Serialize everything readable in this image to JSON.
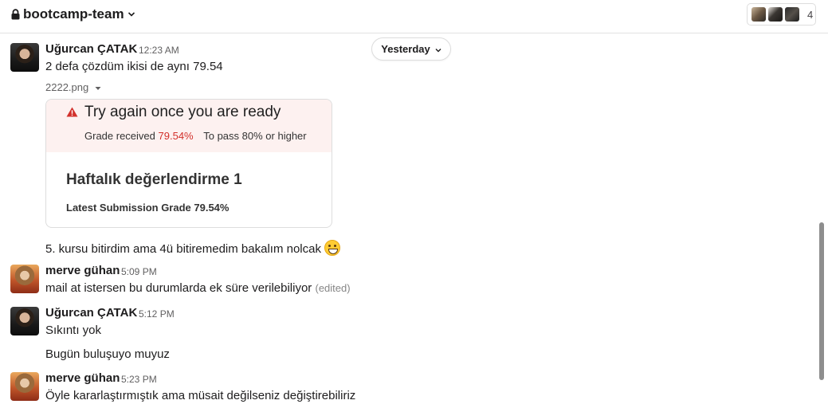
{
  "header": {
    "channel_name": "bootcamp-team",
    "member_count": "4"
  },
  "day_divider": {
    "label": "Yesterday"
  },
  "messages": [
    {
      "author": "Uğurcan ÇATAK",
      "time": "12:23 AM",
      "text": "2 defa çözdüm ikisi de aynı 79.54",
      "file": {
        "name": "2222.png",
        "banner_title": "Try again once you are ready",
        "grade_received_label": "Grade received",
        "grade_received_value": "79.54%",
        "to_pass_label": "To pass",
        "to_pass_value": "80% or higher",
        "assignment_title": "Haftalık değerlendirme 1",
        "latest_submission": "Latest Submission Grade 79.54%"
      },
      "followup": "5. kursu bitirdim ama 4ü bitiremedim bakalım nolcak"
    },
    {
      "author": "merve gühan",
      "time": "5:09 PM",
      "text": "mail at istersen bu durumlarda ek süre verilebiliyor",
      "edited": "(edited)"
    },
    {
      "author": "Uğurcan ÇATAK",
      "time": "5:12 PM",
      "text": "Sıkıntı yok",
      "followup": "Bugün buluşuyo muyuz"
    },
    {
      "author": "merve gühan",
      "time": "5:23 PM",
      "text": "Öyle kararlaştırmıştık ama müsait değilseniz değiştirebiliriz"
    }
  ],
  "colors": {
    "warning_red": "#d2302b",
    "banner_bg": "#fdf1f0",
    "text": "#1d1c1d",
    "muted": "#616061"
  },
  "icons": [
    "lock-icon",
    "chevron-down-icon",
    "warning-icon",
    "grinning-emoji"
  ]
}
